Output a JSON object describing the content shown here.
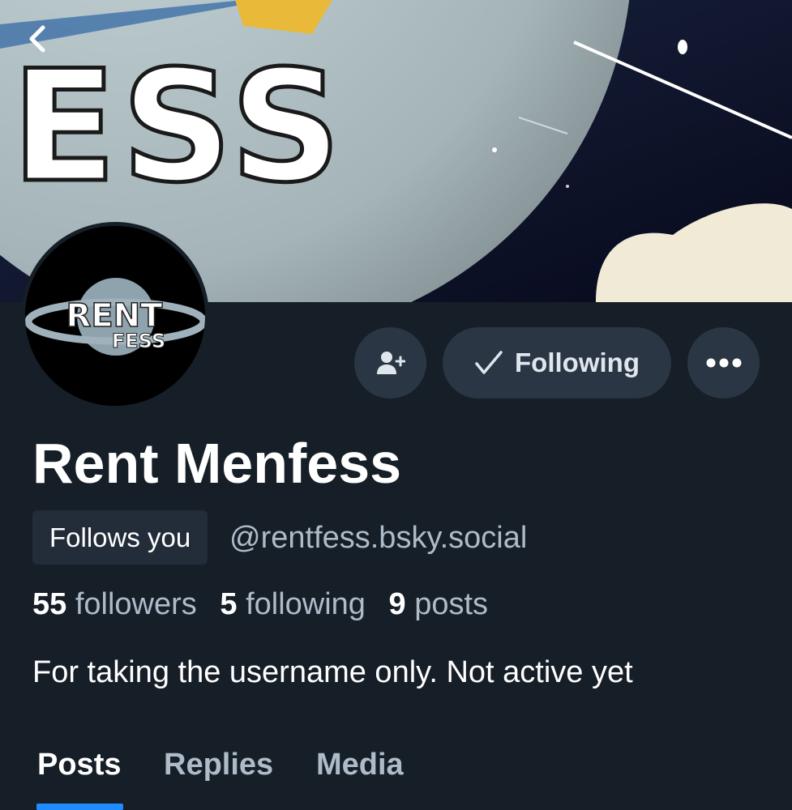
{
  "header": {
    "back_icon": "chevron-left-icon"
  },
  "banner": {
    "text": "ESS"
  },
  "avatar": {
    "logo_line1": "RENT",
    "logo_line2": "FESS"
  },
  "actions": {
    "add_user_icon": "person-plus-icon",
    "following_label": "Following",
    "following_icon": "checkmark-icon",
    "more_icon": "ellipsis-icon"
  },
  "profile": {
    "display_name": "Rent Menfess",
    "follows_you_label": "Follows you",
    "handle": "@rentfess.bsky.social",
    "bio": "For taking the username only. Not active yet"
  },
  "stats": {
    "followers_count": "55",
    "followers_label": "followers",
    "following_count": "5",
    "following_label": "following",
    "posts_count": "9",
    "posts_label": "posts"
  },
  "tabs": [
    {
      "label": "Posts",
      "active": true
    },
    {
      "label": "Replies",
      "active": false
    },
    {
      "label": "Media",
      "active": false
    }
  ],
  "colors": {
    "background": "#161e27",
    "button": "#2a3643",
    "accent": "#208bfe",
    "muted_text": "#aebbc9"
  }
}
